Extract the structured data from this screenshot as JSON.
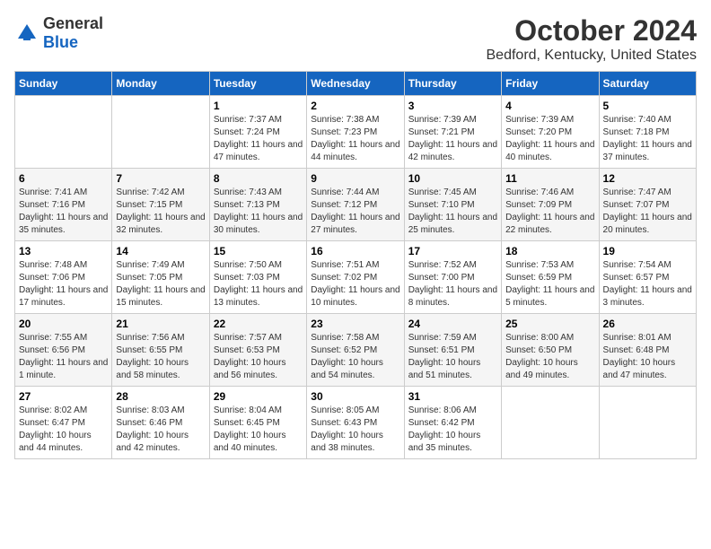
{
  "logo": {
    "text_general": "General",
    "text_blue": "Blue"
  },
  "title": "October 2024",
  "subtitle": "Bedford, Kentucky, United States",
  "days_of_week": [
    "Sunday",
    "Monday",
    "Tuesday",
    "Wednesday",
    "Thursday",
    "Friday",
    "Saturday"
  ],
  "weeks": [
    [
      {
        "day": "",
        "info": ""
      },
      {
        "day": "",
        "info": ""
      },
      {
        "day": "1",
        "info": "Sunrise: 7:37 AM\nSunset: 7:24 PM\nDaylight: 11 hours and 47 minutes."
      },
      {
        "day": "2",
        "info": "Sunrise: 7:38 AM\nSunset: 7:23 PM\nDaylight: 11 hours and 44 minutes."
      },
      {
        "day": "3",
        "info": "Sunrise: 7:39 AM\nSunset: 7:21 PM\nDaylight: 11 hours and 42 minutes."
      },
      {
        "day": "4",
        "info": "Sunrise: 7:39 AM\nSunset: 7:20 PM\nDaylight: 11 hours and 40 minutes."
      },
      {
        "day": "5",
        "info": "Sunrise: 7:40 AM\nSunset: 7:18 PM\nDaylight: 11 hours and 37 minutes."
      }
    ],
    [
      {
        "day": "6",
        "info": "Sunrise: 7:41 AM\nSunset: 7:16 PM\nDaylight: 11 hours and 35 minutes."
      },
      {
        "day": "7",
        "info": "Sunrise: 7:42 AM\nSunset: 7:15 PM\nDaylight: 11 hours and 32 minutes."
      },
      {
        "day": "8",
        "info": "Sunrise: 7:43 AM\nSunset: 7:13 PM\nDaylight: 11 hours and 30 minutes."
      },
      {
        "day": "9",
        "info": "Sunrise: 7:44 AM\nSunset: 7:12 PM\nDaylight: 11 hours and 27 minutes."
      },
      {
        "day": "10",
        "info": "Sunrise: 7:45 AM\nSunset: 7:10 PM\nDaylight: 11 hours and 25 minutes."
      },
      {
        "day": "11",
        "info": "Sunrise: 7:46 AM\nSunset: 7:09 PM\nDaylight: 11 hours and 22 minutes."
      },
      {
        "day": "12",
        "info": "Sunrise: 7:47 AM\nSunset: 7:07 PM\nDaylight: 11 hours and 20 minutes."
      }
    ],
    [
      {
        "day": "13",
        "info": "Sunrise: 7:48 AM\nSunset: 7:06 PM\nDaylight: 11 hours and 17 minutes."
      },
      {
        "day": "14",
        "info": "Sunrise: 7:49 AM\nSunset: 7:05 PM\nDaylight: 11 hours and 15 minutes."
      },
      {
        "day": "15",
        "info": "Sunrise: 7:50 AM\nSunset: 7:03 PM\nDaylight: 11 hours and 13 minutes."
      },
      {
        "day": "16",
        "info": "Sunrise: 7:51 AM\nSunset: 7:02 PM\nDaylight: 11 hours and 10 minutes."
      },
      {
        "day": "17",
        "info": "Sunrise: 7:52 AM\nSunset: 7:00 PM\nDaylight: 11 hours and 8 minutes."
      },
      {
        "day": "18",
        "info": "Sunrise: 7:53 AM\nSunset: 6:59 PM\nDaylight: 11 hours and 5 minutes."
      },
      {
        "day": "19",
        "info": "Sunrise: 7:54 AM\nSunset: 6:57 PM\nDaylight: 11 hours and 3 minutes."
      }
    ],
    [
      {
        "day": "20",
        "info": "Sunrise: 7:55 AM\nSunset: 6:56 PM\nDaylight: 11 hours and 1 minute."
      },
      {
        "day": "21",
        "info": "Sunrise: 7:56 AM\nSunset: 6:55 PM\nDaylight: 10 hours and 58 minutes."
      },
      {
        "day": "22",
        "info": "Sunrise: 7:57 AM\nSunset: 6:53 PM\nDaylight: 10 hours and 56 minutes."
      },
      {
        "day": "23",
        "info": "Sunrise: 7:58 AM\nSunset: 6:52 PM\nDaylight: 10 hours and 54 minutes."
      },
      {
        "day": "24",
        "info": "Sunrise: 7:59 AM\nSunset: 6:51 PM\nDaylight: 10 hours and 51 minutes."
      },
      {
        "day": "25",
        "info": "Sunrise: 8:00 AM\nSunset: 6:50 PM\nDaylight: 10 hours and 49 minutes."
      },
      {
        "day": "26",
        "info": "Sunrise: 8:01 AM\nSunset: 6:48 PM\nDaylight: 10 hours and 47 minutes."
      }
    ],
    [
      {
        "day": "27",
        "info": "Sunrise: 8:02 AM\nSunset: 6:47 PM\nDaylight: 10 hours and 44 minutes."
      },
      {
        "day": "28",
        "info": "Sunrise: 8:03 AM\nSunset: 6:46 PM\nDaylight: 10 hours and 42 minutes."
      },
      {
        "day": "29",
        "info": "Sunrise: 8:04 AM\nSunset: 6:45 PM\nDaylight: 10 hours and 40 minutes."
      },
      {
        "day": "30",
        "info": "Sunrise: 8:05 AM\nSunset: 6:43 PM\nDaylight: 10 hours and 38 minutes."
      },
      {
        "day": "31",
        "info": "Sunrise: 8:06 AM\nSunset: 6:42 PM\nDaylight: 10 hours and 35 minutes."
      },
      {
        "day": "",
        "info": ""
      },
      {
        "day": "",
        "info": ""
      }
    ]
  ]
}
